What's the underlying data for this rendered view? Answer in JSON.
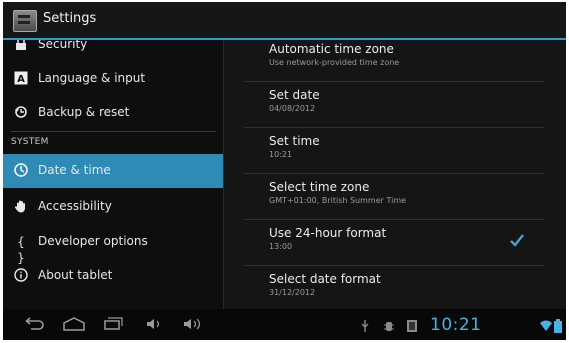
{
  "action_bar": {
    "title": "Settings",
    "app_icon": "settings-app-icon"
  },
  "sidebar": {
    "items_top": [
      {
        "label": "Security",
        "icon": "lock-icon"
      },
      {
        "label": "Language & input",
        "icon": "keyboard-icon"
      },
      {
        "label": "Backup & reset",
        "icon": "backup-icon"
      }
    ],
    "section_header": "SYSTEM",
    "items_system": [
      {
        "label": "Date & time",
        "icon": "clock-icon",
        "selected": true
      },
      {
        "label": "Accessibility",
        "icon": "hand-icon"
      },
      {
        "label": "Developer options",
        "icon": "braces-icon"
      },
      {
        "label": "About tablet",
        "icon": "info-icon"
      }
    ]
  },
  "date_time": {
    "rows": [
      {
        "title": "Automatic time zone",
        "summary": "Use network-provided time zone"
      },
      {
        "title": "Set date",
        "summary": "04/08/2012"
      },
      {
        "title": "Set time",
        "summary": "10:21"
      },
      {
        "title": "Select time zone",
        "summary": "GMT+01:00, British Summer Time"
      },
      {
        "title": "Use 24-hour format",
        "summary": "13:00",
        "checked": true
      },
      {
        "title": "Select date format",
        "summary": "31/12/2012"
      }
    ]
  },
  "nav_bar": {
    "buttons": [
      "back-icon",
      "home-icon",
      "recent-apps-icon",
      "volume-down-icon",
      "volume-up-icon"
    ],
    "status_icons": [
      "usb-icon",
      "usb-debugging-icon",
      "download-icon",
      "wifi-icon",
      "battery-icon"
    ],
    "clock": "10:21"
  },
  "colors": {
    "accent": "#2d8bb6",
    "clock": "#46b3e8",
    "background": "#141414"
  }
}
